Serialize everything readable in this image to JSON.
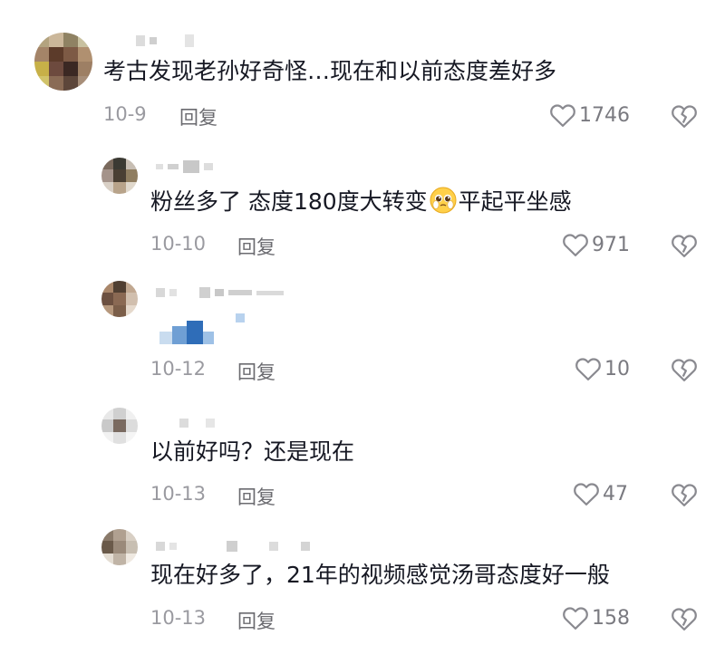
{
  "comments": [
    {
      "level": "top",
      "text": "考古发现老孙好奇怪…现在和以前态度差好多",
      "date": "10-9",
      "reply_label": "回复",
      "likes": "1746",
      "avatar_colors": [
        "#b3a37f",
        "#cbb79a",
        "#8f8263",
        "#c8c1a0",
        "#a48468",
        "#5c3b2a",
        "#7d5a45",
        "#b09070",
        "#c7b048",
        "#6d4a3e",
        "#3b2823",
        "#9d7f64",
        "#d1c36a",
        "#8a6b55",
        "#5d463a",
        "#a78e79"
      ]
    },
    {
      "level": "reply",
      "text_before": "粉丝多了 态度180度大转变",
      "emoji": "pleading-face-emoji",
      "text_after": "平起平坐感",
      "date": "10-10",
      "reply_label": "回复",
      "likes": "971",
      "avatar_colors": [
        "#7a6a5d",
        "#3b3a33",
        "#c7beb3",
        "#a4938a",
        "#4a3f33",
        "#8f7d60",
        "#d9d0c6",
        "#b8a38a",
        "#e0d8cc"
      ]
    },
    {
      "level": "reply",
      "text": "",
      "date": "10-12",
      "reply_label": "回复",
      "likes": "10",
      "avatar_colors": [
        "#a9866a",
        "#503f32",
        "#c1a891",
        "#6c5040",
        "#8a6953",
        "#d1bfae",
        "#b6987d",
        "#7b5e49",
        "#e5d9cc"
      ]
    },
    {
      "level": "reply",
      "text": "以前好吗？还是现在",
      "date": "10-13",
      "reply_label": "回复",
      "likes": "47",
      "avatar_colors": [
        "#e8e8e8",
        "#d0d0d0",
        "#f0f0f0",
        "#c9c9c9",
        "#7a6a60",
        "#dcdcdc",
        "#f2f2f2",
        "#e0e0e0",
        "#f5f5f5"
      ]
    },
    {
      "level": "reply",
      "text": "现在好多了，21年的视频感觉汤哥态度好一般",
      "date": "10-13",
      "reply_label": "回复",
      "likes": "158",
      "avatar_colors": [
        "#8a7a6a",
        "#b0a090",
        "#d8cfc4",
        "#6a5a4a",
        "#9a8a7a",
        "#c8bfb2",
        "#e4ddd3",
        "#c0b4a6",
        "#efe9e1"
      ]
    }
  ]
}
